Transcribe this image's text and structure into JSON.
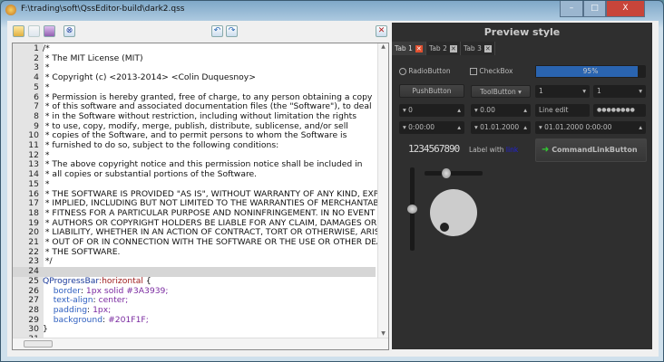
{
  "window": {
    "title": "F:\\trading\\soft\\QssEditor-build\\dark2.qss",
    "controls": [
      "–",
      "□",
      "X"
    ]
  },
  "toolbar": {
    "icons": [
      "open-icon",
      "save-icon",
      "save-as-icon",
      "close-file-icon",
      "undo-icon",
      "redo-icon",
      "toggle-preview-icon"
    ]
  },
  "editor": {
    "current_line": 24,
    "lines": [
      {
        "n": "1",
        "t": "/*"
      },
      {
        "n": "2",
        "t": " * The MIT License (MIT)"
      },
      {
        "n": "3",
        "t": " *"
      },
      {
        "n": "4",
        "t": " * Copyright (c) <2013-2014> <Colin Duquesnoy>"
      },
      {
        "n": "5",
        "t": " *"
      },
      {
        "n": "6",
        "t": " * Permission is hereby granted, free of charge, to any person obtaining a copy"
      },
      {
        "n": "7",
        "t": " * of this software and associated documentation files (the \"Software\"), to deal"
      },
      {
        "n": "8",
        "t": " * in the Software without restriction, including without limitation the rights"
      },
      {
        "n": "9",
        "t": " * to use, copy, modify, merge, publish, distribute, sublicense, and/or sell"
      },
      {
        "n": "10",
        "t": " * copies of the Software, and to permit persons to whom the Software is"
      },
      {
        "n": "11",
        "t": " * furnished to do so, subject to the following conditions:"
      },
      {
        "n": "12",
        "t": " *"
      },
      {
        "n": "13",
        "t": " * The above copyright notice and this permission notice shall be included in"
      },
      {
        "n": "14",
        "t": " * all copies or substantial portions of the Software."
      },
      {
        "n": "15",
        "t": " *"
      },
      {
        "n": "16",
        "t": " * THE SOFTWARE IS PROVIDED \"AS IS\", WITHOUT WARRANTY OF ANY KIND, EXPRESS OR"
      },
      {
        "n": "17",
        "t": " * IMPLIED, INCLUDING BUT NOT LIMITED TO THE WARRANTIES OF MERCHANTABILITY,"
      },
      {
        "n": "18",
        "t": " * FITNESS FOR A PARTICULAR PURPOSE AND NONINFRINGEMENT. IN NO EVENT SHALL THE"
      },
      {
        "n": "19",
        "t": " * AUTHORS OR COPYRIGHT HOLDERS BE LIABLE FOR ANY CLAIM, DAMAGES OR OTHER"
      },
      {
        "n": "20",
        "t": " * LIABILITY, WHETHER IN AN ACTION OF CONTRACT, TORT OR OTHERWISE, ARISING FROM,"
      },
      {
        "n": "21",
        "t": " * OUT OF OR IN CONNECTION WITH THE SOFTWARE OR THE USE OR OTHER DEALINGS IN"
      },
      {
        "n": "22",
        "t": " * THE SOFTWARE."
      },
      {
        "n": "23",
        "t": " */"
      },
      {
        "n": "24",
        "t": ""
      }
    ],
    "css_block": {
      "l25": {
        "n": "25",
        "sel": "QProgressBar",
        "pseudo": ":horizontal",
        "brace": " {"
      },
      "props": [
        {
          "n": "26",
          "p": "border",
          "v": "1px solid #3A3939;"
        },
        {
          "n": "27",
          "p": "text-align",
          "v": "center;"
        },
        {
          "n": "28",
          "p": "padding",
          "v": "1px;"
        },
        {
          "n": "29",
          "p": "background",
          "v": "#201F1F;"
        }
      ],
      "l30": {
        "n": "30",
        "t": "}"
      },
      "l31": {
        "n": "31",
        "t": ""
      }
    }
  },
  "preview": {
    "title": "Preview style",
    "tabs": [
      {
        "label": "Tab 1",
        "close": "✕"
      },
      {
        "label": "Tab 2",
        "close": "✕"
      },
      {
        "label": "Tab 3",
        "close": "✕"
      }
    ],
    "radio": "RadioButton",
    "checkbox": "CheckBox",
    "progress": {
      "value": 95,
      "text": "95%",
      "color": "#2a64b0"
    },
    "pushbutton": "PushButton",
    "toolbutton": "ToolButton",
    "combo1": "1",
    "combo2": "1",
    "spin_int": "0",
    "spin_double": "0.00",
    "line_edit": "Line edit",
    "password": "●●●●●●●●",
    "time": "0:00:00",
    "date": "01.01.2000",
    "datetime": "01.01.2000 0:00:00",
    "lcd": "1234567890",
    "label_prefix": "Label with ",
    "label_link": "link",
    "command_link": "CommandLinkButton",
    "hslider_value": 0.35,
    "vslider_value": 0.5,
    "accent": "#2f2f2f"
  }
}
